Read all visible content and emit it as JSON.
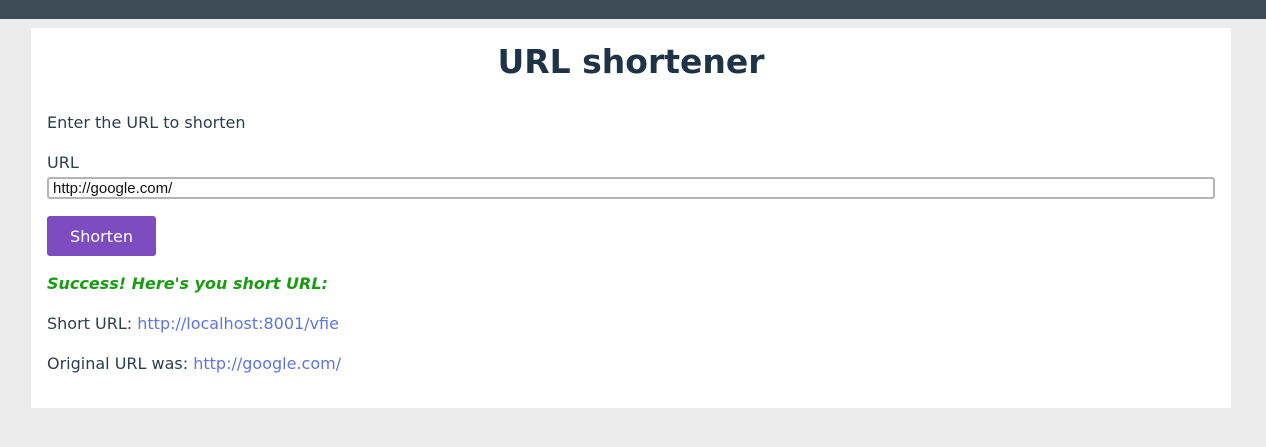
{
  "page": {
    "title": "URL shortener",
    "intro": "Enter the URL to shorten"
  },
  "form": {
    "url_label": "URL",
    "url_value": "http://google.com/",
    "submit_label": "Shorten"
  },
  "result": {
    "success_message": "Success! Here's you short URL:",
    "short_url_label": "Short URL: ",
    "short_url": "http://localhost:8001/vfie",
    "original_url_label": "Original URL was: ",
    "original_url": "http://google.com/"
  },
  "colors": {
    "topbar": "#3e4c57",
    "button": "#7d4cc0",
    "success": "#1a9c12",
    "link": "#5f74e0"
  }
}
